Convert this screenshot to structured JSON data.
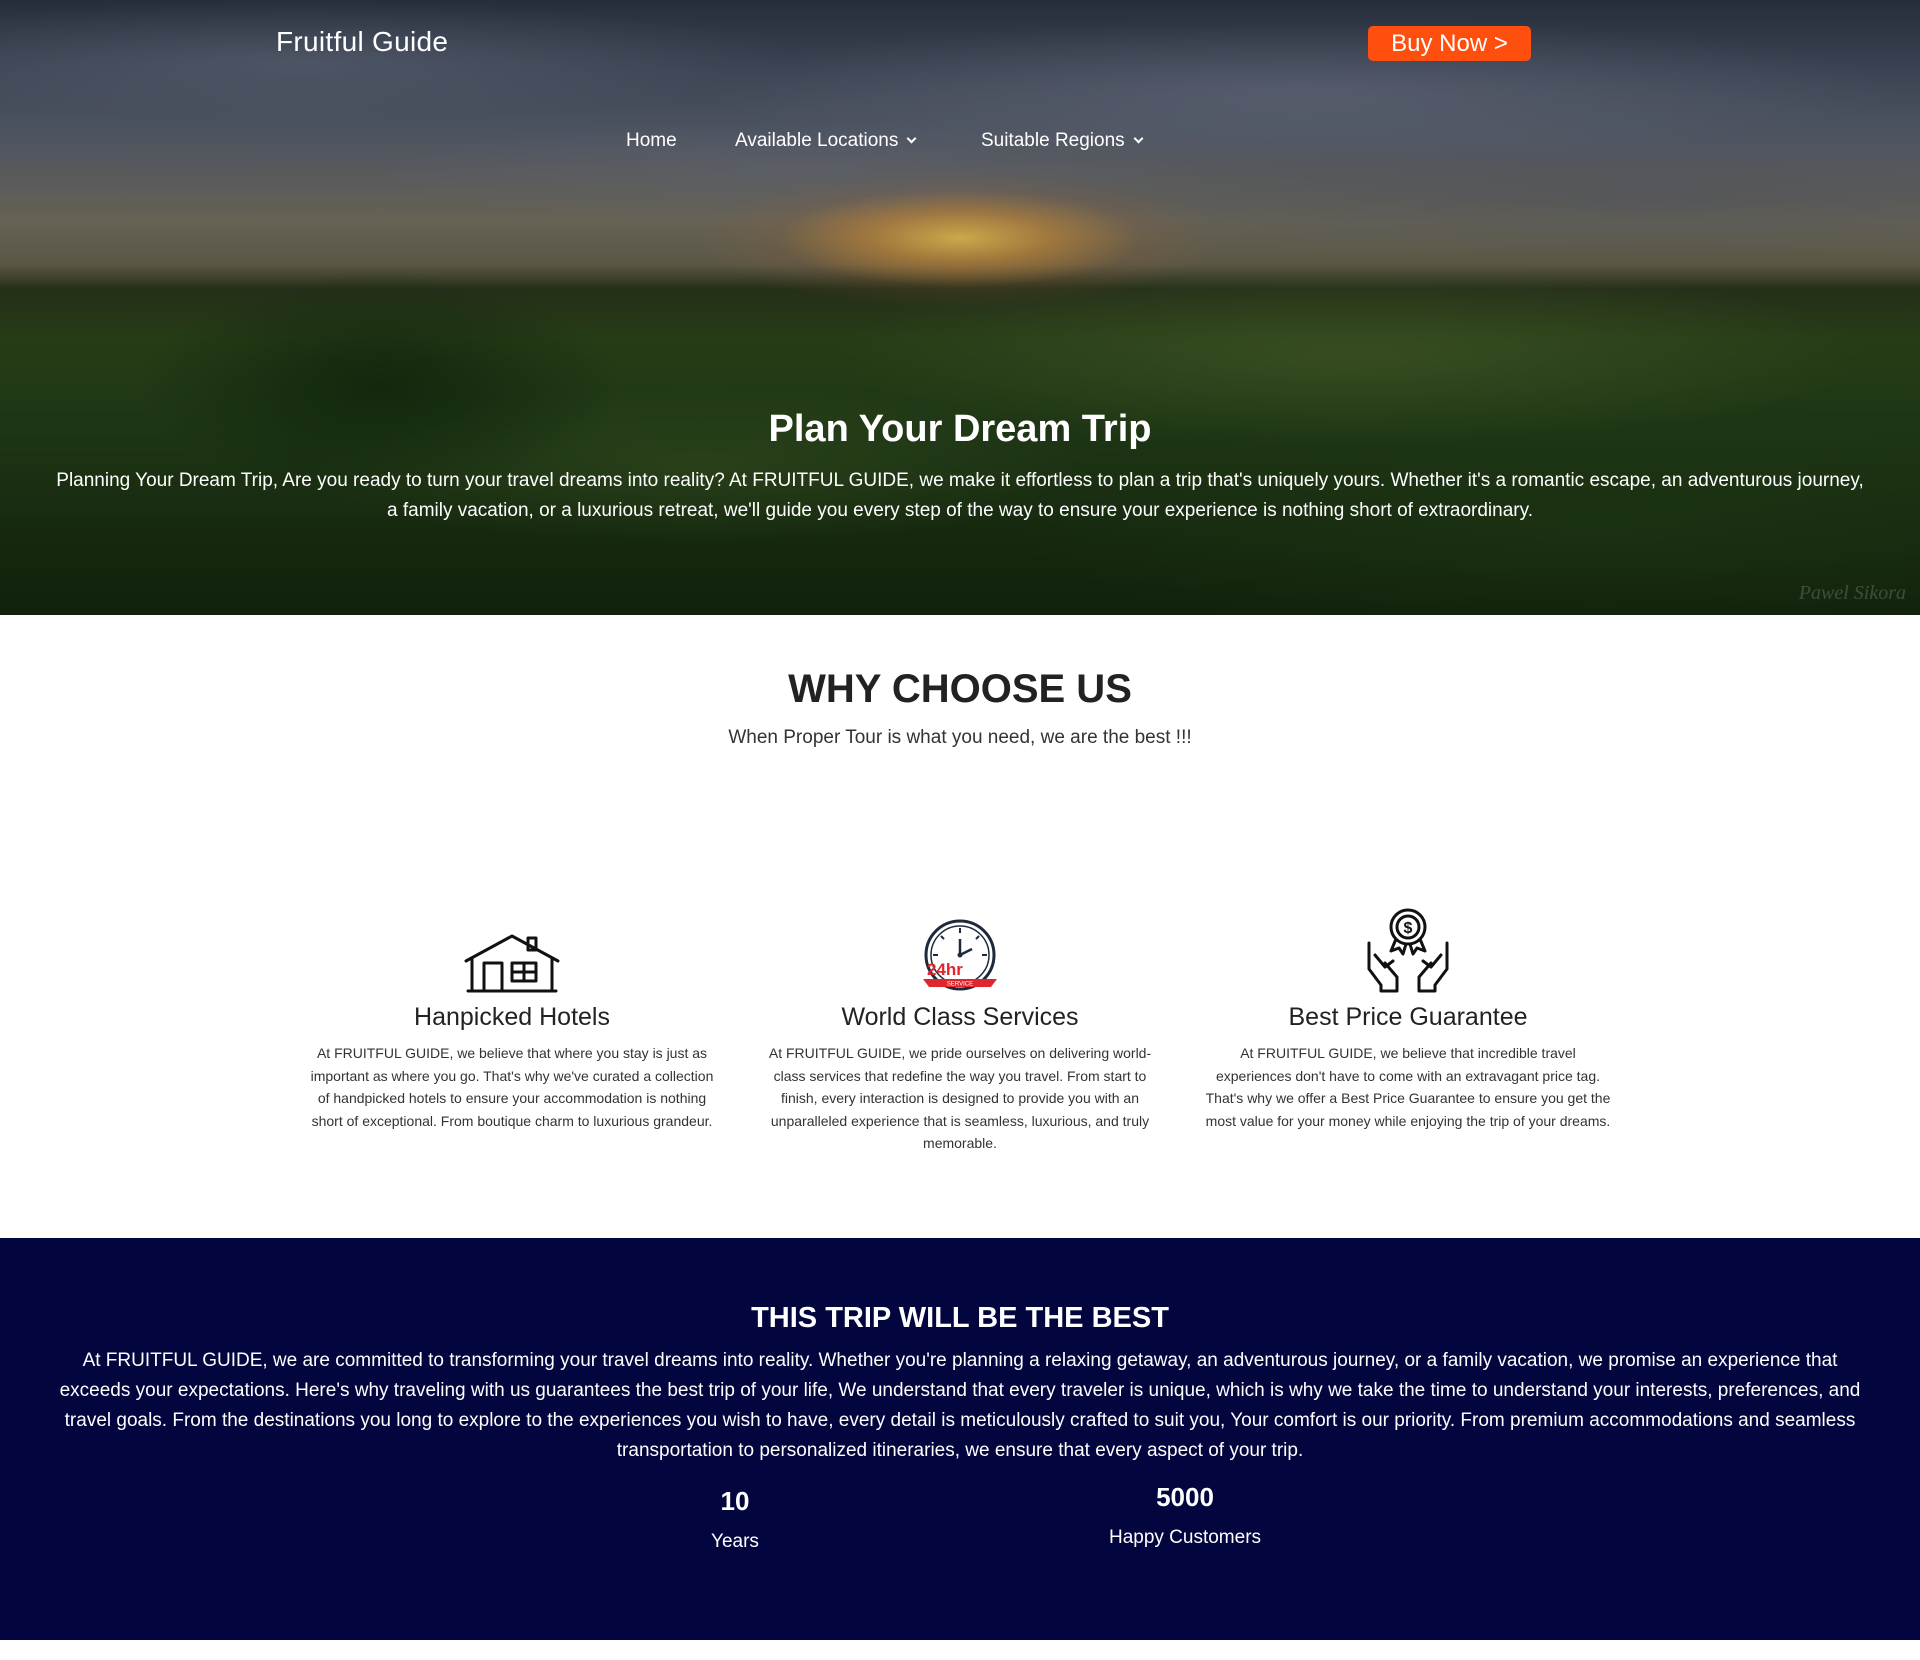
{
  "header": {
    "brand": "Fruitful Guide",
    "buy_button": "Buy Now >"
  },
  "nav": {
    "items": [
      {
        "label": "Home",
        "has_dropdown": false
      },
      {
        "label": "Available Locations",
        "has_dropdown": true
      },
      {
        "label": "Suitable Regions",
        "has_dropdown": true
      }
    ]
  },
  "hero": {
    "title": "Plan Your Dream Trip",
    "text": "Planning Your Dream Trip, Are you ready to turn your travel dreams into reality? At FRUITFUL GUIDE, we make it effortless to plan a trip that's uniquely yours. Whether it's a romantic escape, an adventurous journey, a family vacation, or a luxurious retreat, we'll guide you every step of the way to ensure your experience is nothing short of extraordinary.",
    "watermark": "Pawel Sikora"
  },
  "why": {
    "title": "WHY CHOOSE US",
    "subtitle": "When Proper Tour is what you need, we are the best !!!",
    "features": [
      {
        "icon": "house-icon",
        "title": "Hanpicked Hotels",
        "text": "At FRUITFUL GUIDE, we believe that where you stay is just as important as where you go. That's why we've curated a collection of handpicked hotels to ensure your accommodation is nothing short of exceptional. From boutique charm to luxurious grandeur."
      },
      {
        "icon": "clock-24hr-icon",
        "title": "World Class Services",
        "text": "At FRUITFUL GUIDE, we pride ourselves on delivering world-class services that redefine the way you travel. From start to finish, every interaction is designed to provide you with an unparalleled experience that is seamless, luxurious, and truly memorable."
      },
      {
        "icon": "price-hands-icon",
        "title": "Best Price Guarantee",
        "text": "At FRUITFUL GUIDE, we believe that incredible travel experiences don't have to come with an extravagant price tag. That's why we offer a Best Price Guarantee to ensure you get the most value for your money while enjoying the trip of your dreams."
      }
    ],
    "clock_badge": {
      "big": "24hr",
      "small": "SERVICE"
    },
    "price_symbol": "$"
  },
  "best": {
    "title": "THIS TRIP WILL BE THE BEST",
    "text": "At FRUITFUL GUIDE, we are committed to transforming your travel dreams into reality. Whether you're planning a relaxing getaway, an adventurous journey, or a family vacation, we promise an experience that exceeds your expectations. Here's why traveling with us guarantees the best trip of your life, We understand that every traveler is unique, which is why we take the time to understand your interests, preferences, and travel goals. From the destinations you long to explore to the experiences you wish to have, every detail is meticulously crafted to suit you, Your comfort is our priority. From premium accommodations and seamless transportation to personalized itineraries, we ensure that every aspect of your trip.",
    "stats": [
      {
        "number": "10",
        "label": "Years"
      },
      {
        "number": "5000",
        "label": "Happy Customers"
      }
    ]
  },
  "colors": {
    "buy_button": "#ff4f0f",
    "stats_background": "#03053e",
    "clock_accent": "#e0262d"
  }
}
